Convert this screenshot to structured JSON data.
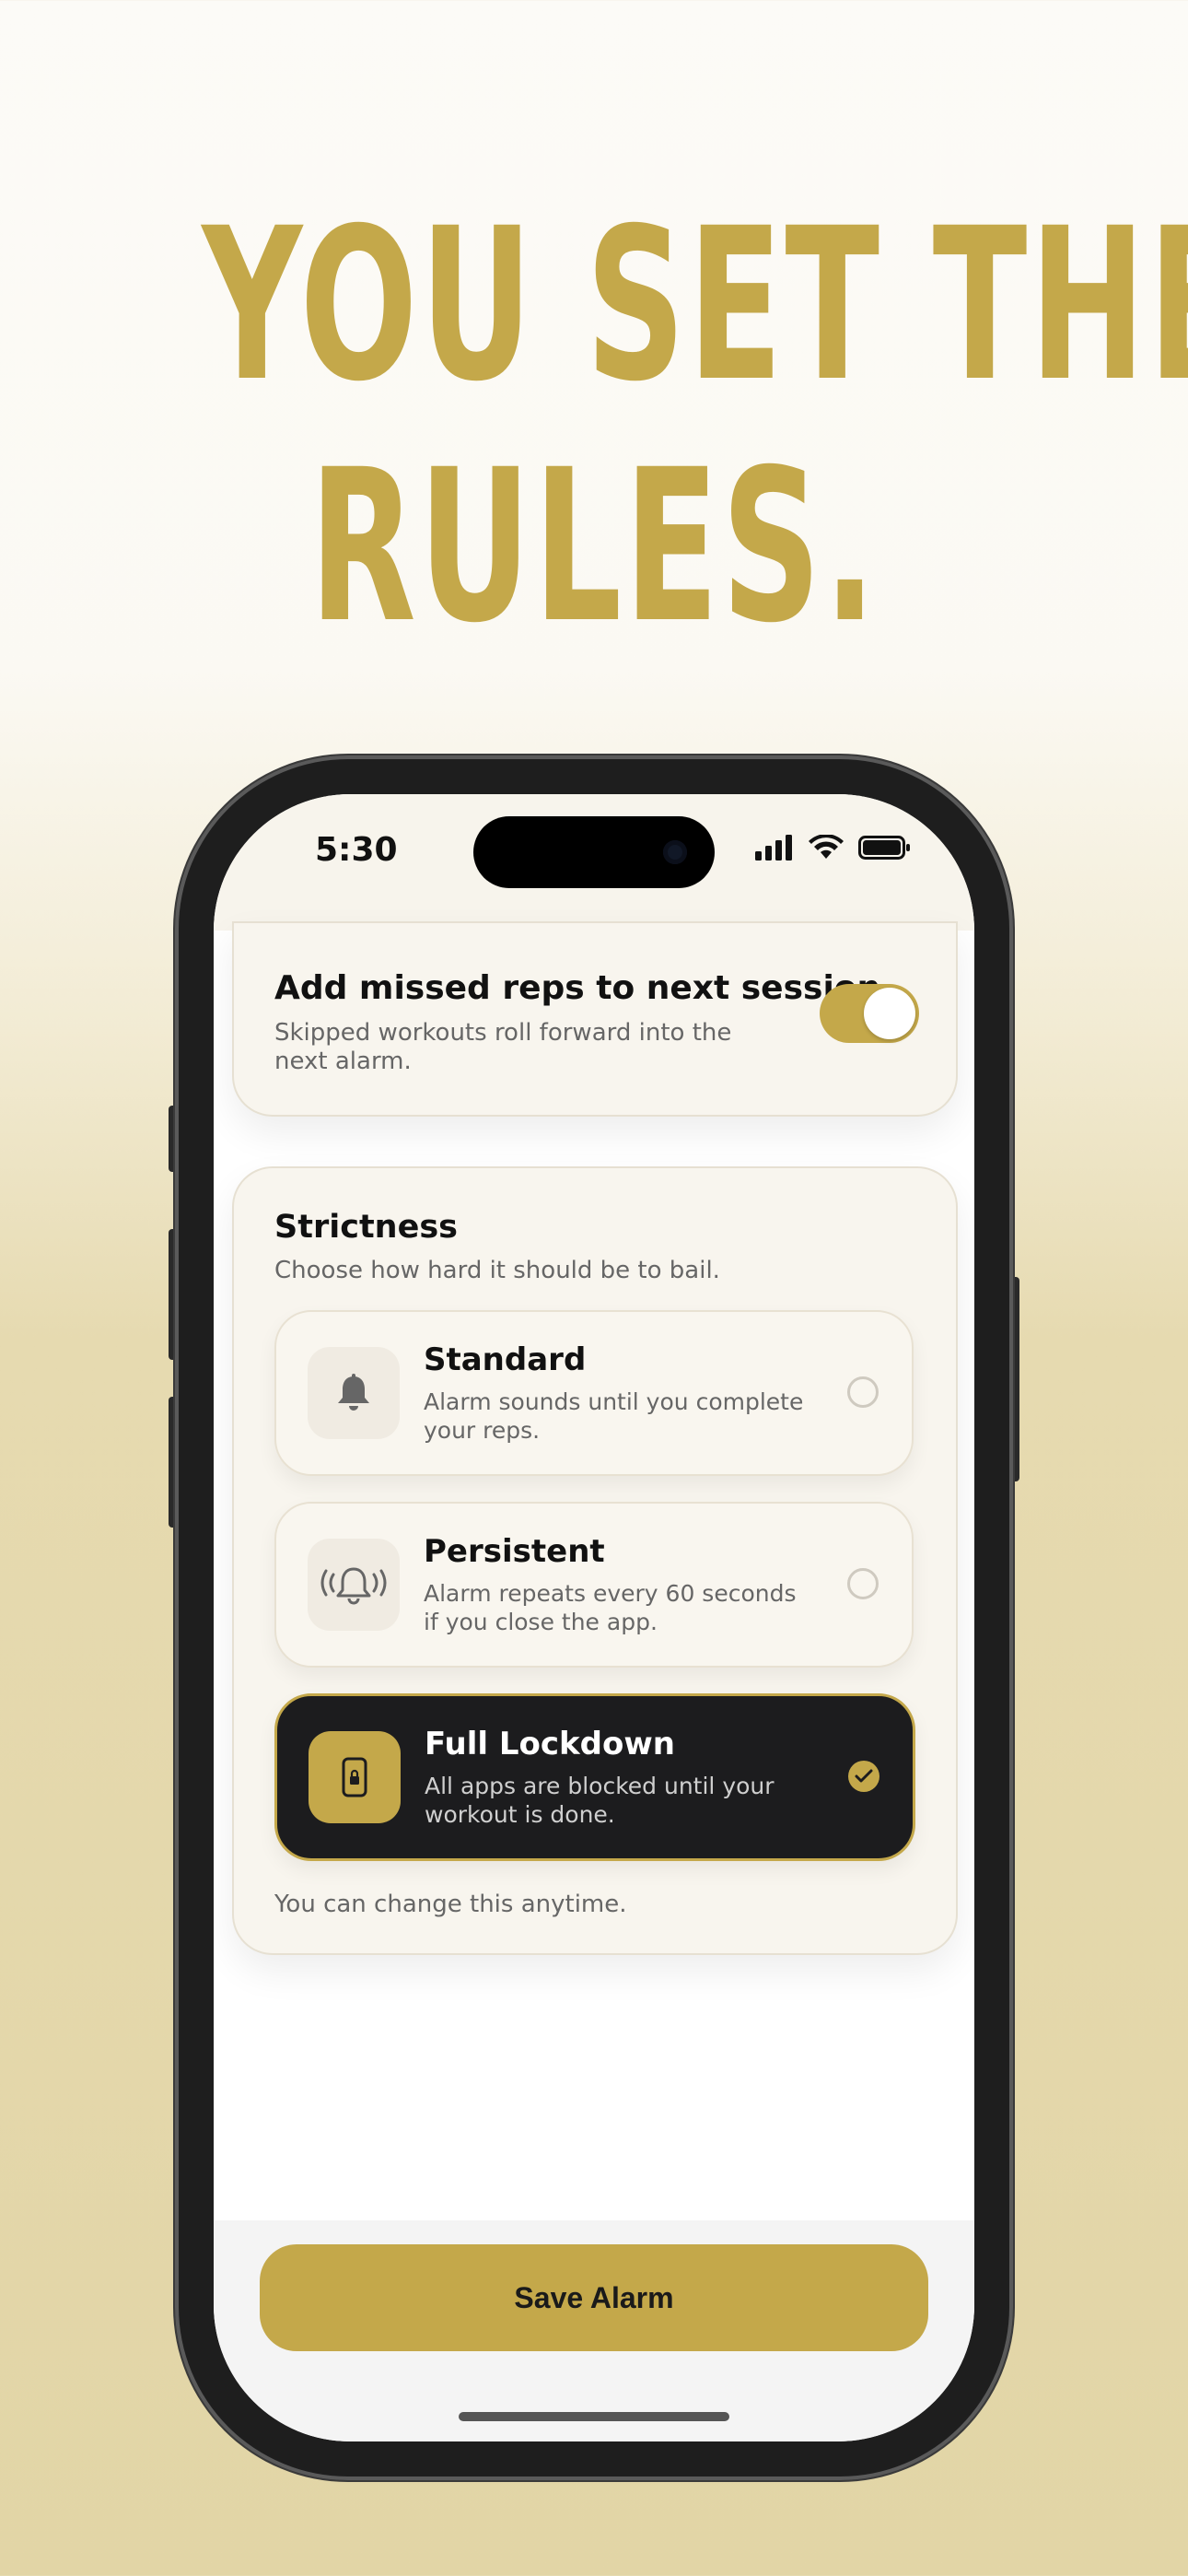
{
  "headline": {
    "line1": "YOU SET THE",
    "line2": "RULES."
  },
  "status_bar": {
    "time": "5:30",
    "icons": [
      "signal-icon",
      "wifi-icon",
      "battery-icon"
    ]
  },
  "carry_over": {
    "title": "Add missed reps to next session",
    "subtitle": "Skipped workouts roll forward into the next alarm.",
    "enabled": true
  },
  "strictness": {
    "title": "Strictness",
    "subtitle": "Choose how hard it should be to bail.",
    "options": [
      {
        "title": "Standard",
        "description": "Alarm sounds until you complete your reps.",
        "icon": "bell-icon",
        "selected": false
      },
      {
        "title": "Persistent",
        "description": "Alarm repeats every 60 seconds if you close the app.",
        "icon": "ringing-bell-icon",
        "selected": false
      },
      {
        "title": "Full Lockdown",
        "description": "All apps are blocked until your workout is done.",
        "icon": "locked-phone-icon",
        "selected": true
      }
    ],
    "footnote": "You can change this anytime."
  },
  "save_button": {
    "label": "Save Alarm"
  },
  "colors": {
    "accent": "#c4a84a",
    "selected_bg": "#1c1c1e",
    "card_bg": "#f8f5ee"
  }
}
